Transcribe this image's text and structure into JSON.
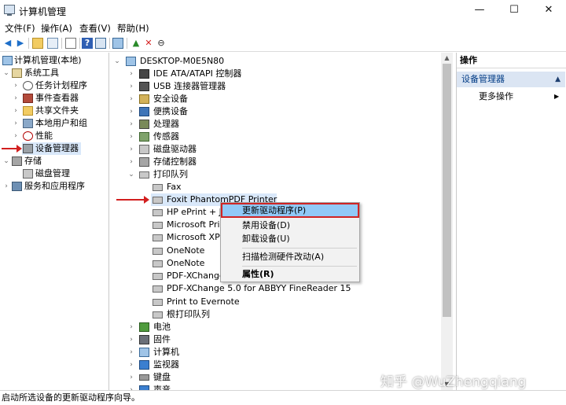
{
  "window": {
    "title": "计算机管理",
    "minimize": "—",
    "maximize": "☐",
    "close": "✕"
  },
  "menu": [
    "文件(F)",
    "操作(A)",
    "查看(V)",
    "帮助(H)"
  ],
  "left_tree": {
    "root": "计算机管理(本地)",
    "system_tools": "系统工具",
    "task_scheduler": "任务计划程序",
    "event_viewer": "事件查看器",
    "shared_folders": "共享文件夹",
    "local_users": "本地用户和组",
    "performance": "性能",
    "device_manager": "设备管理器",
    "storage": "存储",
    "disk_management": "磁盘管理",
    "services_apps": "服务和应用程序"
  },
  "device_tree": {
    "computer": "DESKTOP-M0E5N80",
    "ide": "IDE ATA/ATAPI 控制器",
    "usb": "USB 连接器管理器",
    "security": "安全设备",
    "portable": "便携设备",
    "processors": "处理器",
    "sensors": "传感器",
    "disk_drives": "磁盘驱动器",
    "storage_ctrl": "存储控制器",
    "print_queues": "打印队列",
    "printers": [
      "Fax",
      "Foxit PhantomPDF Printer",
      "HP ePrint + J",
      "Microsoft Pri",
      "Microsoft XP",
      "OneNote",
      "OneNote",
      "PDF-XChange",
      "PDF-XChange 5.0 for ABBYY FineReader 15",
      "Print to Evernote",
      "根打印队列"
    ],
    "battery": "电池",
    "firmware": "固件",
    "computer_cat": "计算机",
    "monitors": "监视器",
    "keyboard": "键盘",
    "partial": "声音"
  },
  "actions": {
    "title": "操作",
    "section": "设备管理器",
    "more": "更多操作"
  },
  "context_menu": {
    "update_driver": "更新驱动程序(P)",
    "disable": "禁用设备(D)",
    "uninstall": "卸载设备(U)",
    "scan": "扫描检测硬件改动(A)",
    "properties": "属性(R)"
  },
  "status": "启动所选设备的更新驱动程序向导。",
  "watermark": "知乎 @WuZhengqiang"
}
